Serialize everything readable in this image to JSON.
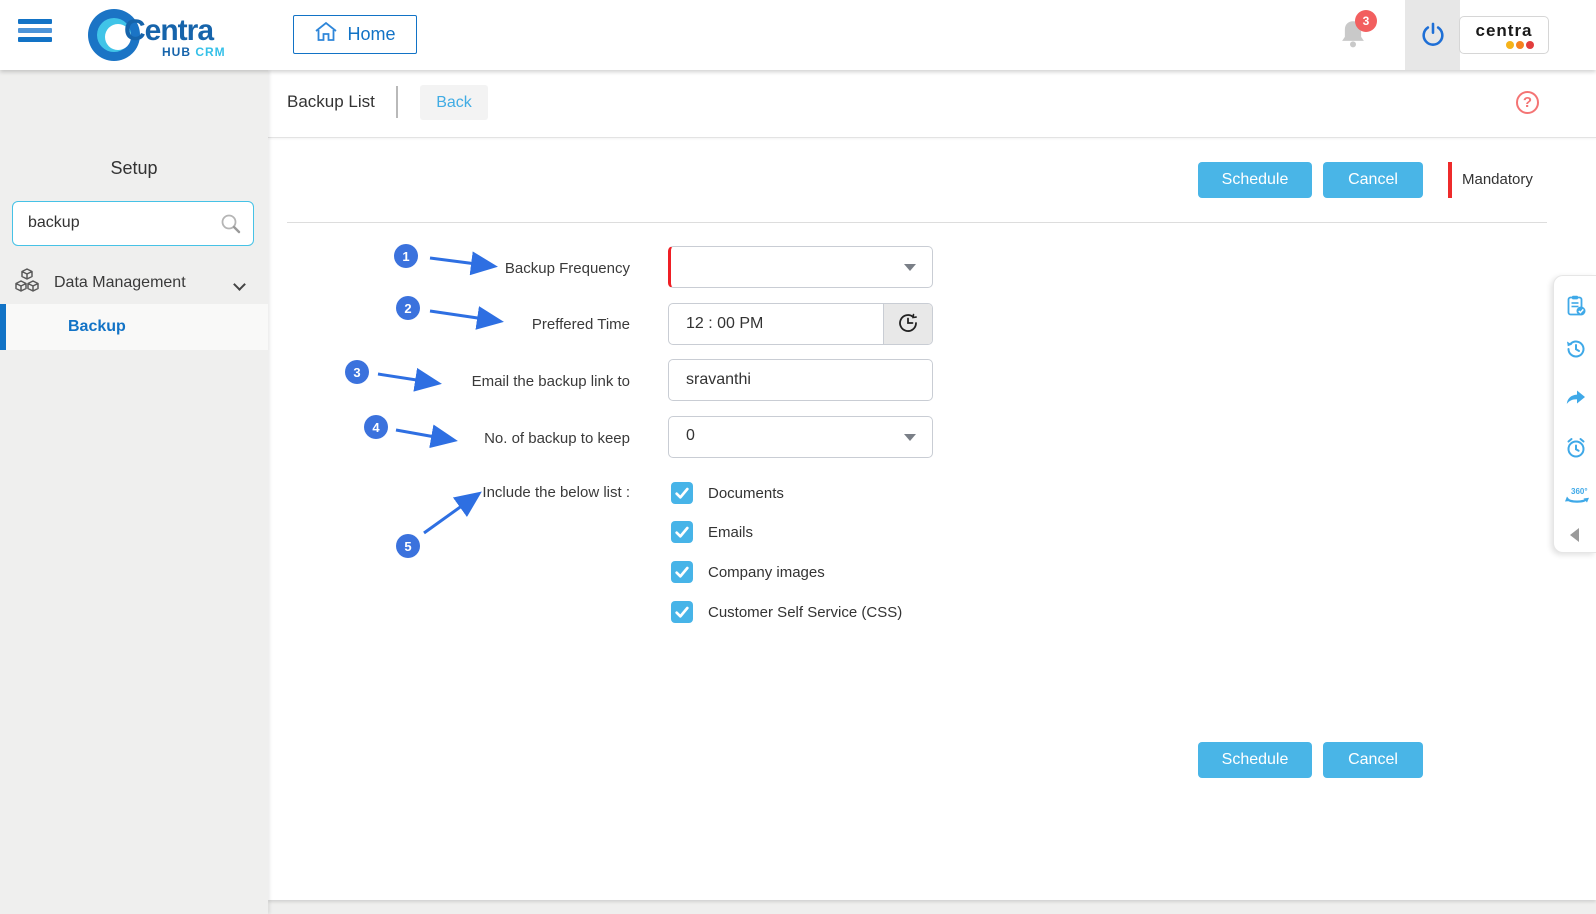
{
  "topbar": {
    "brand": {
      "name": "Centra",
      "sub_hub": "HUB",
      "sub_crm": "CRM"
    },
    "home_label": "Home",
    "notification_count": "3",
    "partner_logo_text": "centra"
  },
  "sidebar": {
    "title": "Setup",
    "search": {
      "value": "backup"
    },
    "group": {
      "label": "Data Management"
    },
    "active_item": {
      "label": "Backup"
    }
  },
  "header": {
    "title": "Backup List",
    "back_label": "Back",
    "help_glyph": "?"
  },
  "actions": {
    "schedule_label": "Schedule",
    "cancel_label": "Cancel",
    "mandatory_label": "Mandatory"
  },
  "form": {
    "rows": [
      {
        "num": "1",
        "label": "Backup Frequency",
        "value": ""
      },
      {
        "num": "2",
        "label": "Preffered Time",
        "value": "12 : 00 PM"
      },
      {
        "num": "3",
        "label": "Email the backup link to",
        "value": "sravanthi"
      },
      {
        "num": "4",
        "label": "No. of backup to keep",
        "value": "0"
      },
      {
        "num": "5",
        "label": "Include the below list :"
      }
    ],
    "include_options": [
      {
        "label": "Documents",
        "checked": true
      },
      {
        "label": "Emails",
        "checked": true
      },
      {
        "label": "Company images",
        "checked": true
      },
      {
        "label": "Customer Self Service (CSS)",
        "checked": true
      }
    ]
  },
  "colors": {
    "accent_blue": "#49b5e7",
    "brand_blue": "#1273c6",
    "annotation_blue": "#3b72dd",
    "mandatory_red": "#ee2b2b",
    "badge_red": "#f25f5f",
    "toolbar_icon_blue": "#3fa9e8"
  }
}
